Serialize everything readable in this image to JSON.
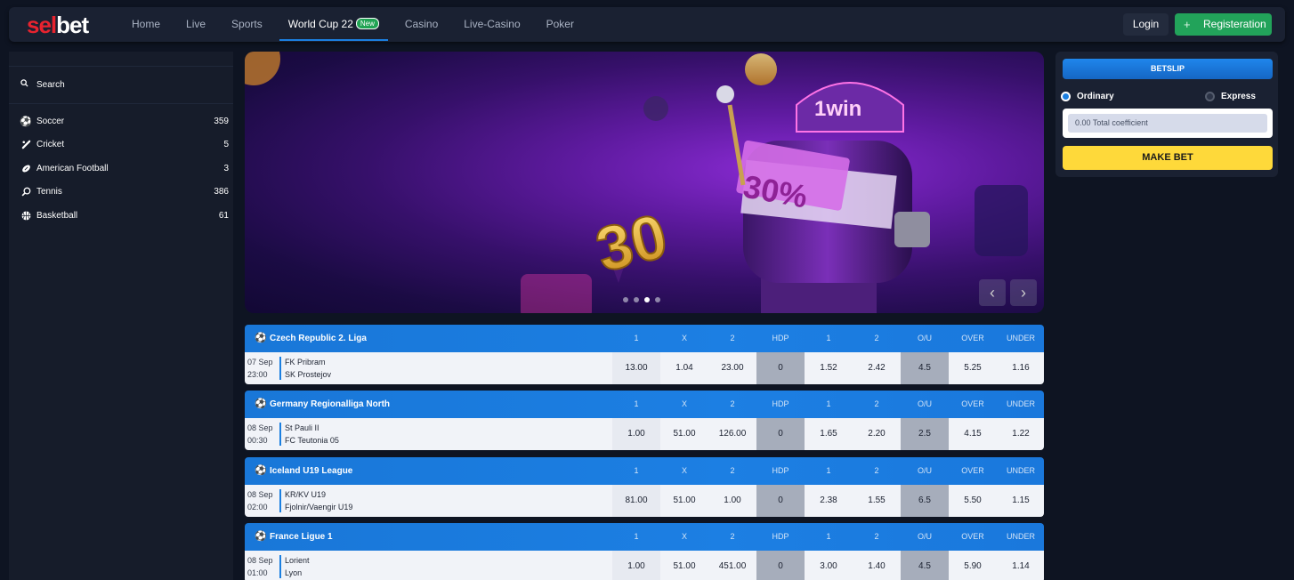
{
  "brand": {
    "logo_a": "sel",
    "logo_b": "bet"
  },
  "nav": {
    "items": [
      "Home",
      "Live",
      "Sports",
      "World Cup 22",
      "Casino",
      "Live-Casino",
      "Poker"
    ],
    "new_badge": "New",
    "active": "World Cup 22"
  },
  "auth": {
    "login": "Login",
    "register": "Registeration"
  },
  "sidebar": {
    "search_label": "Search",
    "sports": [
      {
        "name": "Soccer",
        "count": "359",
        "icon": "soccer-ball-icon"
      },
      {
        "name": "Cricket",
        "count": "5",
        "icon": "cricket-bat-icon"
      },
      {
        "name": "American Football",
        "count": "3",
        "icon": "american-football-icon"
      },
      {
        "name": "Tennis",
        "count": "386",
        "icon": "tennis-racket-icon"
      },
      {
        "name": "Basketball",
        "count": "61",
        "icon": "basketball-icon"
      }
    ]
  },
  "banner": {
    "brand_text": "1win",
    "promo_value": "30",
    "promo_percent": "30%",
    "slides": 4,
    "active_slide": 3
  },
  "betslip": {
    "title": "BETSLIP",
    "ordinary": "Ordinary",
    "express": "Express",
    "coefficient": "0.00 Total coefficient",
    "make_bet": "MAKE BET"
  },
  "columns": [
    "1",
    "X",
    "2",
    "HDP",
    "1",
    "2",
    "O/U",
    "OVER",
    "UNDER"
  ],
  "leagues": [
    {
      "name": "Czech Republic 2. Liga",
      "date": "07 Sep",
      "time": "23:00",
      "home": "FK Pribram",
      "away": "SK Prostejov",
      "odds": [
        "13.00",
        "1.04",
        "23.00",
        "0",
        "1.52",
        "2.42",
        "4.5",
        "5.25",
        "1.16"
      ]
    },
    {
      "name": "Germany Regionalliga North",
      "date": "08 Sep",
      "time": "00:30",
      "home": "St Pauli II",
      "away": "FC Teutonia 05",
      "odds": [
        "1.00",
        "51.00",
        "126.00",
        "0",
        "1.65",
        "2.20",
        "2.5",
        "4.15",
        "1.22"
      ]
    },
    {
      "name": "Iceland U19 League",
      "date": "08 Sep",
      "time": "02:00",
      "home": "KR/KV U19",
      "away": "Fjolnir/Vaengir U19",
      "odds": [
        "81.00",
        "51.00",
        "1.00",
        "0",
        "2.38",
        "1.55",
        "6.5",
        "5.50",
        "1.15"
      ]
    },
    {
      "name": "France Ligue 1",
      "date": "08 Sep",
      "time": "01:00",
      "home": "Lorient",
      "away": "Lyon",
      "odds": [
        "1.00",
        "51.00",
        "451.00",
        "0",
        "3.00",
        "1.40",
        "4.5",
        "5.90",
        "1.14"
      ]
    }
  ]
}
